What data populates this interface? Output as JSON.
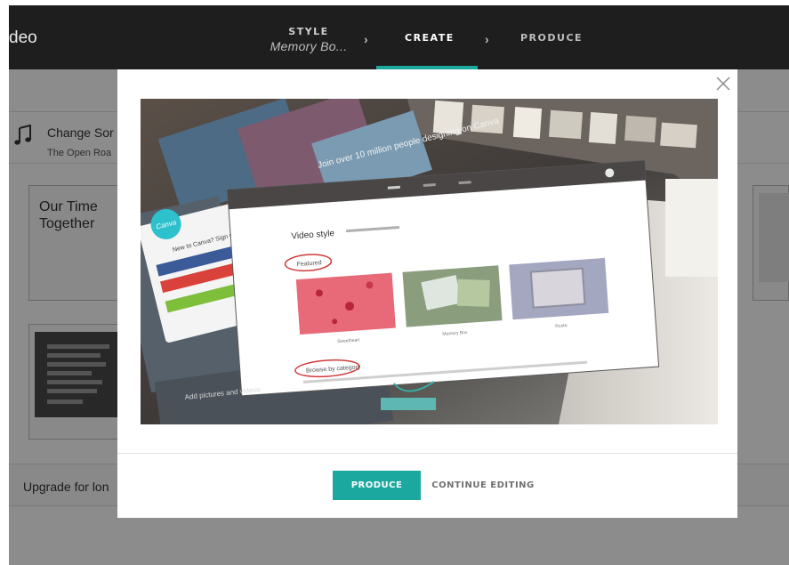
{
  "header": {
    "app_title": "deo",
    "steps": [
      {
        "label": "STYLE",
        "sublabel": "Memory Bo..."
      },
      {
        "label": "CREATE"
      },
      {
        "label": "PRODUCE"
      }
    ],
    "separator_glyph": "›"
  },
  "editor": {
    "song_title": "Change Sor",
    "song_subtitle": "The Open Roa",
    "title_card_text": "Our Time Together",
    "upgrade_text": "Upgrade for lon"
  },
  "modal": {
    "close_glyph": "×",
    "produce_label": "PRODUCE",
    "continue_label": "CONTINUE EDITING",
    "preview": {
      "signup_title": "New to Canva? Sign up!",
      "logo_text": "Canva",
      "join_text": "Join over 10 million people designing on Canva",
      "video_style_label": "Video style",
      "featured_label": "Featured",
      "browse_label": "Browse by category",
      "style_names": [
        "Sweetheart",
        "Memory Box",
        "Rustic"
      ],
      "add_text": "Add pictures and videos"
    }
  },
  "colors": {
    "accent": "#1ba89f",
    "topbar_bg": "#1e1e1e",
    "modal_bg": "#ffffff"
  }
}
